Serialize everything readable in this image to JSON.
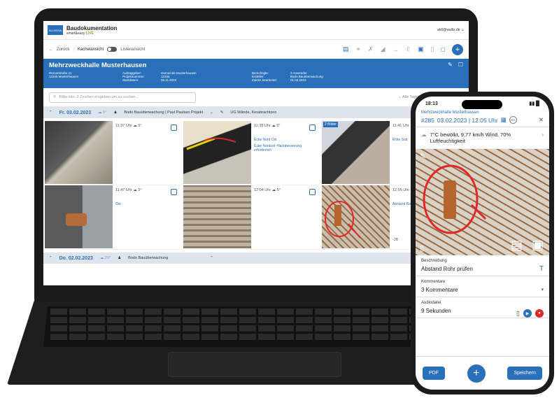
{
  "app": {
    "title": "Baudokumentation",
    "subtitle_prefix": "smart&easy ",
    "subtitle_accent": "LIVE",
    "user_email": "ak6@wallis.de",
    "logo_text": "ALLNOVA"
  },
  "toolbar": {
    "back_label": "Zurück",
    "tile_view_label": "Kachelansicht",
    "list_view_label": "Listenansicht"
  },
  "project": {
    "title": "Mehrzweckhalle Musterhausen",
    "address_line1": "Römerstraße 21",
    "address_line2": "12345 Musterhausen",
    "labels": [
      "Auftraggeber:",
      "Projektnummer:",
      "Startdatum:"
    ],
    "values": [
      "Gemeinde Musterhausen",
      "12345",
      "06.11.2022"
    ],
    "labels2": [
      "Berechtigte:",
      "Ersteller:",
      "Zuletzt bearbeitet:"
    ],
    "values2": [
      "3 Anwender",
      "Bodo Bauüberwachung",
      "01.03.2023"
    ]
  },
  "search": {
    "placeholder": "Bitte min. 3 Zeichen eingeben um zu suchen...",
    "expand_all": "Alle Tagesinformationen aufklappen"
  },
  "day1": {
    "date": "Fr. 03.02.2023",
    "temp": "5°",
    "people": "Bodo Bauüberwachung | Paul Paulsen Projekt",
    "extra": "UG Wände, Kerabrachtzen"
  },
  "cards": [
    {
      "time": "11:37 Uhr",
      "temp": "5°",
      "desc": ""
    },
    {
      "time": "11:38 Uhr",
      "temp": "5°",
      "desc": "Ecke Nord Ost",
      "desc2": "Ecke Nordost -Nachbesserung erforderlich"
    },
    {
      "time": "11:41 Uhr",
      "temp": "",
      "desc": "Ecke Süd",
      "badge": "2 Bilder"
    },
    {
      "time": "11:47 Uhr",
      "temp": "5°",
      "desc": "Ost"
    },
    {
      "time": "12:04 Uhr",
      "temp": "5°",
      "desc": ""
    },
    {
      "time": "12:05 Uhr",
      "temp": "",
      "desc": "Abstand Rohr",
      "extra": "-28"
    }
  ],
  "day2": {
    "date": "Do. 02.02.2023",
    "temp": "20°",
    "people": "Bodo Bauüberwachung"
  },
  "phone": {
    "time": "18:13",
    "project": "Mehrzweckhalle Musterhausen",
    "entry_id": "#285",
    "entry_datetime": "03.02.2023 | 12:05 Uhr",
    "rr": "RR",
    "weather": "7°C bewölkt, 9,77 km/h Wind, 70% Luftfeuchtigkeit",
    "desc_label": "Beschreibung",
    "desc_value": "Abstand Rohr prüfen",
    "comments_label": "Kommentare",
    "comments_value": "3 Kommentare",
    "audio_label": "Audiodatei",
    "audio_value": "9 Sekunden",
    "pdf_label": "PDF",
    "save_label": "Speichern"
  },
  "colors": {
    "brand": "#2a6fb9",
    "accent": "#7bb32e",
    "header_bg": "#2a6fb9"
  }
}
